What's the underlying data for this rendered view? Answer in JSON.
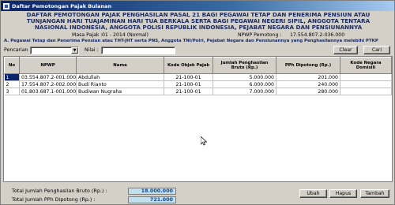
{
  "window": {
    "title": "Daftar Pemotongan Pajak Bulanan"
  },
  "header": {
    "line1": "DAFTAR PEMOTONGAN PAJAK PENGHASILAN PASAL 21 BAGI PEGAWAI TETAP DAN PENERIMA PENSIUN ATAU",
    "line2": "TUNJANGAN HARI TUAJAMINAN HARI TUA BERKALA SERTA BAGI PEGAWAI NEGERI SIPIL, ANGGOTA TENTARA",
    "line3": "NASIONAL INDONESIA, ANGGOTA POLISI REPUBLIK INDONESIA, PEJABAT NEGARA DAN PENSIUNANNYA",
    "masa_pajak_label": "Masa Pajak :",
    "masa_pajak_value": "01 - 2014 (Normal)",
    "npwp_pemotong_label": "NPWP Pemotong :",
    "npwp_pemotong_value": "17.554.807.2-036.000",
    "subtitle": "A. Pegawai Tetap dan Penerima Pensiun atau THT-JHT serta PNS, Anggota TNI/Polri, Pejabat Negara dan Pensiunannya yang Penghasilannya melebihi PTKP"
  },
  "filter": {
    "pencarian_label": "Pencarian :",
    "pencarian_value": "",
    "nilai_label": "Nilai :",
    "nilai_value": "",
    "clear_label": "Clear",
    "cari_label": "Cari"
  },
  "table": {
    "columns": [
      "No",
      "NPWP",
      "Nama",
      "Kode Objek Pajak",
      "Jumlah Penghasilan Bruto (Rp.)",
      "PPh Dipotong (Rp.)",
      "Kode Negara Domisili"
    ],
    "rows": [
      {
        "no": "1",
        "npwp": "03.554.807.2-001.000",
        "nama": "Abdullah",
        "kode": "21-100-01",
        "bruto": "5.000.000",
        "pph": "201.000",
        "negara": ""
      },
      {
        "no": "2",
        "npwp": "17.554.807.2-002.000",
        "nama": "Budi Rianto",
        "kode": "21-100-01",
        "bruto": "6.000.000",
        "pph": "240.000",
        "negara": ""
      },
      {
        "no": "3",
        "npwp": "01.803.687.1-001.000",
        "nama": "Budiwan Nugraha",
        "kode": "21-100-01",
        "bruto": "7.000.000",
        "pph": "280.000",
        "negara": ""
      }
    ]
  },
  "totals": {
    "bruto_label": "Total Jumlah Penghasilan Bruto (Rp.) :",
    "bruto_value": "18.000.000",
    "pph_label": "Total Jumlah PPh Dipotong (Rp.) :",
    "pph_value": "721.000"
  },
  "actions": {
    "ubah_label": "Ubah",
    "hapus_label": "Hapus",
    "tambah_label": "Tambah"
  },
  "colors": {
    "title_bar": "#0a246a",
    "header_text": "#1a2a5e",
    "total_field_bg": "#bfe0ec"
  }
}
